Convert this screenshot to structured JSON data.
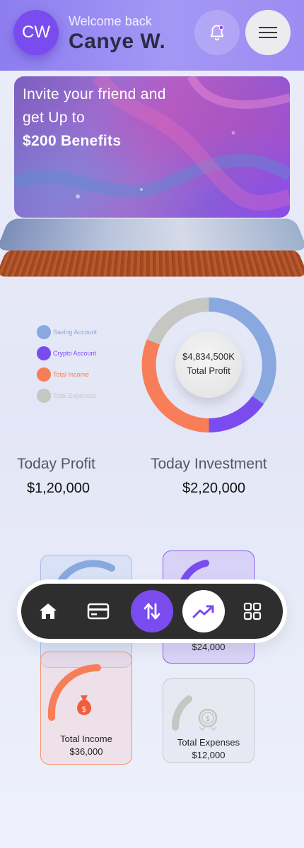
{
  "header": {
    "avatar_initials": "CW",
    "welcome": "Welcome back",
    "username": "Canye W."
  },
  "promo": {
    "line1": "Invite your friend and",
    "line2": "get Up to",
    "line3": "$200 Benefits"
  },
  "legend": [
    {
      "label": "Saving Account",
      "color": "#8aa8e0"
    },
    {
      "label": "Crypto Account",
      "color": "#7a4cf0"
    },
    {
      "label": "Total Income",
      "color": "#f77e58"
    },
    {
      "label": "Total Expenses",
      "color": "#c6c6c2"
    }
  ],
  "donut": {
    "value": "$4,834,500K",
    "label": "Total Profit"
  },
  "stats": {
    "profit_title": "Today Profit",
    "profit_value": "$1,20,000",
    "investment_title": "Today Investment",
    "investment_value": "$2,20,000"
  },
  "tiles": {
    "crypto_value": "$24,000",
    "income_label": "Total Income",
    "income_value": "$36,000",
    "expenses_label": "Total Expenses",
    "expenses_value": "$12,000"
  },
  "nav": {
    "items": [
      "home-icon",
      "card-icon",
      "transfer-icon",
      "trending-up-icon",
      "grid-icon"
    ],
    "active": "trending-up-icon"
  },
  "colors": {
    "accent": "#7a4cf0",
    "income": "#f77e58",
    "saving": "#8aa8e0",
    "expenses": "#c6c6c2",
    "nav_bg": "#2e2e2e"
  }
}
